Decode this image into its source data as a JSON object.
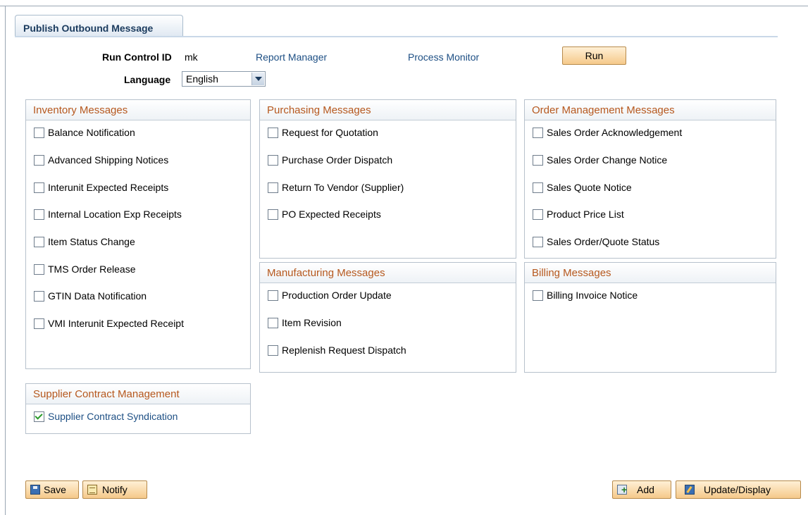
{
  "tab": {
    "label": "Publish Outbound Message"
  },
  "header": {
    "run_control_label": "Run Control ID",
    "run_control_value": "mk",
    "report_manager": "Report Manager",
    "process_monitor": "Process Monitor",
    "run_label": "Run",
    "language_label": "Language",
    "language_value": "English"
  },
  "groups": {
    "inventory": {
      "title": "Inventory Messages",
      "items": [
        {
          "label": "Balance Notification",
          "checked": false
        },
        {
          "label": "Advanced Shipping Notices",
          "checked": false
        },
        {
          "label": "Interunit Expected Receipts",
          "checked": false
        },
        {
          "label": "Internal Location Exp Receipts",
          "checked": false
        },
        {
          "label": "Item Status Change",
          "checked": false
        },
        {
          "label": "TMS Order Release",
          "checked": false
        },
        {
          "label": "GTIN Data Notification",
          "checked": false
        },
        {
          "label": "VMI Interunit Expected Receipt",
          "checked": false
        }
      ]
    },
    "purchasing": {
      "title": "Purchasing Messages",
      "items": [
        {
          "label": "Request for Quotation",
          "checked": false
        },
        {
          "label": "Purchase Order Dispatch",
          "checked": false
        },
        {
          "label": "Return To Vendor (Supplier)",
          "checked": false
        },
        {
          "label": "PO Expected Receipts",
          "checked": false
        }
      ]
    },
    "order_management": {
      "title": "Order Management Messages",
      "items": [
        {
          "label": "Sales Order Acknowledgement",
          "checked": false
        },
        {
          "label": "Sales Order Change Notice",
          "checked": false
        },
        {
          "label": "Sales Quote Notice",
          "checked": false
        },
        {
          "label": "Product Price List",
          "checked": false
        },
        {
          "label": "Sales Order/Quote Status",
          "checked": false
        }
      ]
    },
    "manufacturing": {
      "title": "Manufacturing Messages",
      "items": [
        {
          "label": "Production Order Update",
          "checked": false
        },
        {
          "label": "Item Revision",
          "checked": false
        },
        {
          "label": "Replenish Request Dispatch",
          "checked": false
        }
      ]
    },
    "billing": {
      "title": "Billing Messages",
      "items": [
        {
          "label": "Billing Invoice Notice",
          "checked": false
        }
      ]
    },
    "supplier_contract": {
      "title": "Supplier Contract Management",
      "items": [
        {
          "label": "Supplier Contract Syndication",
          "checked": true
        }
      ]
    }
  },
  "toolbar": {
    "save_label": "Save",
    "notify_label": "Notify",
    "add_label": "Add",
    "update_display_label": "Update/Display"
  }
}
